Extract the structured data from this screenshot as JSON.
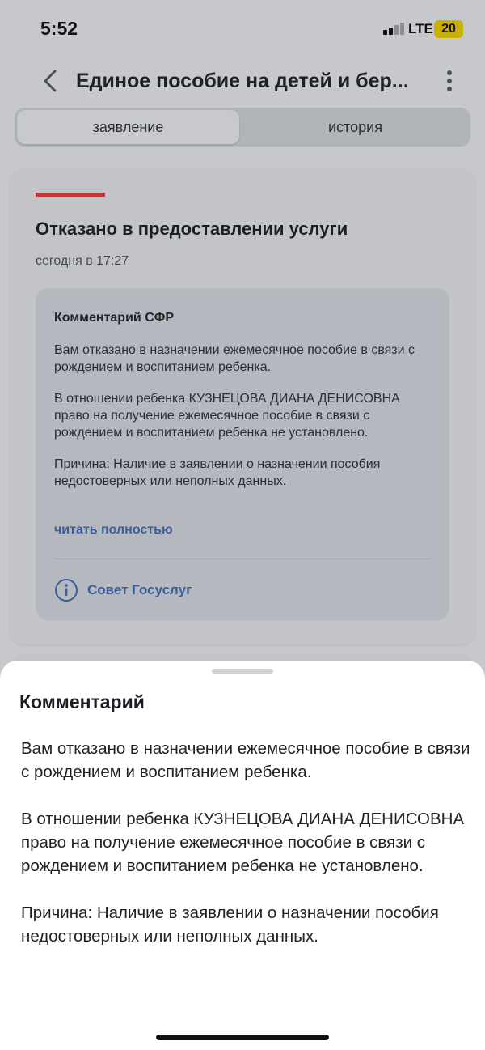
{
  "status_bar": {
    "time": "5:52",
    "network": "LTE",
    "battery": "20",
    "battery_color": "#c9b100"
  },
  "header": {
    "title": "Единое пособие на детей и бер...",
    "back_icon": "chevron-left-icon",
    "menu_icon": "more-vertical-icon"
  },
  "tabs": [
    {
      "label": "заявление",
      "active": true
    },
    {
      "label": "история",
      "active": false
    }
  ],
  "card": {
    "status_color": "#c6353a",
    "title": "Отказано в предоставлении услуги",
    "time": "сегодня в 17:27",
    "comment": {
      "heading": "Комментарий СФР",
      "paragraphs": [
        "Вам отказано в назначении ежемесячное пособие в связи с рождением и воспитанием ребенка.",
        "В отношении ребенка КУЗНЕЦОВА ДИАНА ДЕНИСОВНА право на получение ежемесячное пособие в связи с рождением и воспитанием ребенка не установлено.",
        "Причина: Наличие в заявлении о назначении пособия недостоверных или неполных данных."
      ],
      "read_more": "читать полностью",
      "advice_icon": "info-icon",
      "advice_label": "Совет Госуслуг"
    }
  },
  "sheet": {
    "title": "Комментарий",
    "paragraphs": [
      "Вам отказано в назначении ежемесячное пособие в связи с рождением и воспитанием ребенка.",
      "В отношении ребенка КУЗНЕЦОВА ДИАНА ДЕНИСОВНА право на получение ежемесячное пособие в связи с рождением и воспитанием ребенка не установлено.",
      "Причина: Наличие в заявлении о назначении пособия недостоверных или неполных данных."
    ]
  },
  "colors": {
    "link": "#3b5d9b",
    "accent_red": "#c6353a"
  }
}
